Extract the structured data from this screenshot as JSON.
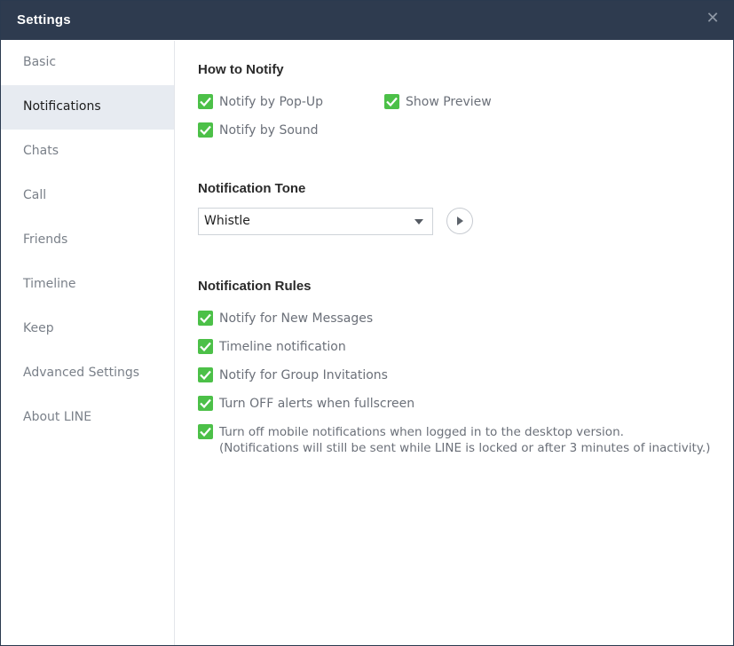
{
  "window": {
    "title": "Settings",
    "close_icon": "close-icon"
  },
  "sidebar": {
    "items": [
      {
        "label": "Basic",
        "active": false
      },
      {
        "label": "Notifications",
        "active": true
      },
      {
        "label": "Chats",
        "active": false
      },
      {
        "label": "Call",
        "active": false
      },
      {
        "label": "Friends",
        "active": false
      },
      {
        "label": "Timeline",
        "active": false
      },
      {
        "label": "Keep",
        "active": false
      },
      {
        "label": "Advanced Settings",
        "active": false
      },
      {
        "label": "About LINE",
        "active": false
      }
    ]
  },
  "how_to_notify": {
    "title": "How to Notify",
    "popup": {
      "label": "Notify by Pop-Up",
      "checked": true
    },
    "preview": {
      "label": "Show Preview",
      "checked": true
    },
    "sound": {
      "label": "Notify by Sound",
      "checked": true
    }
  },
  "tone": {
    "title": "Notification Tone",
    "selected": "Whistle",
    "play_icon": "play-icon"
  },
  "rules": {
    "title": "Notification Rules",
    "items": [
      {
        "label": "Notify for New Messages",
        "checked": true
      },
      {
        "label": "Timeline notification",
        "checked": true
      },
      {
        "label": "Notify for Group Invitations",
        "checked": true
      },
      {
        "label": "Turn OFF alerts when fullscreen",
        "checked": true
      },
      {
        "label": "Turn off mobile notifications when logged in to the desktop version.",
        "sublabel": "(Notifications will still be sent while LINE is locked or after 3 minutes of inactivity.)",
        "checked": true
      }
    ]
  },
  "colors": {
    "titlebar": "#2e3b4f",
    "checkbox": "#4cc048",
    "active_item": "#e7ebf1"
  }
}
